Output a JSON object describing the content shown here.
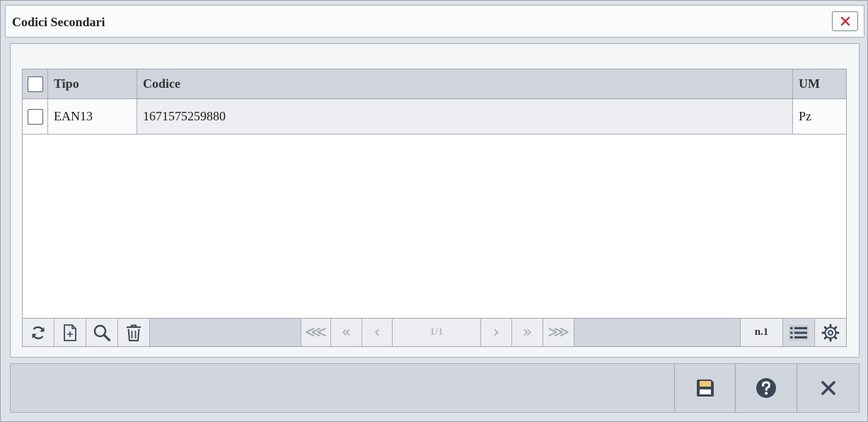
{
  "window": {
    "title": "Codici Secondari",
    "close_icon": "close-icon"
  },
  "grid": {
    "columns": [
      "",
      "Tipo",
      "Codice",
      "UM"
    ],
    "rows": [
      {
        "checked": false,
        "tipo": "EAN13",
        "codice": "1671575259880",
        "um": "Pz"
      }
    ]
  },
  "toolbar": {
    "buttons": [
      "refresh-icon",
      "new-record-icon",
      "search-icon",
      "trash-icon"
    ],
    "pager": "1/1",
    "count": "n.1",
    "nav": {
      "first": "⋘",
      "prev_page": "«",
      "prev": "‹",
      "next": "›",
      "next_page": "»",
      "last": "⋙"
    }
  },
  "footer": {
    "buttons": [
      "save-icon",
      "help-icon",
      "close-icon"
    ]
  },
  "colors": {
    "accent_close": "#c0393b",
    "icon_dark": "#3c4656",
    "save_yellow": "#f2c86a"
  }
}
